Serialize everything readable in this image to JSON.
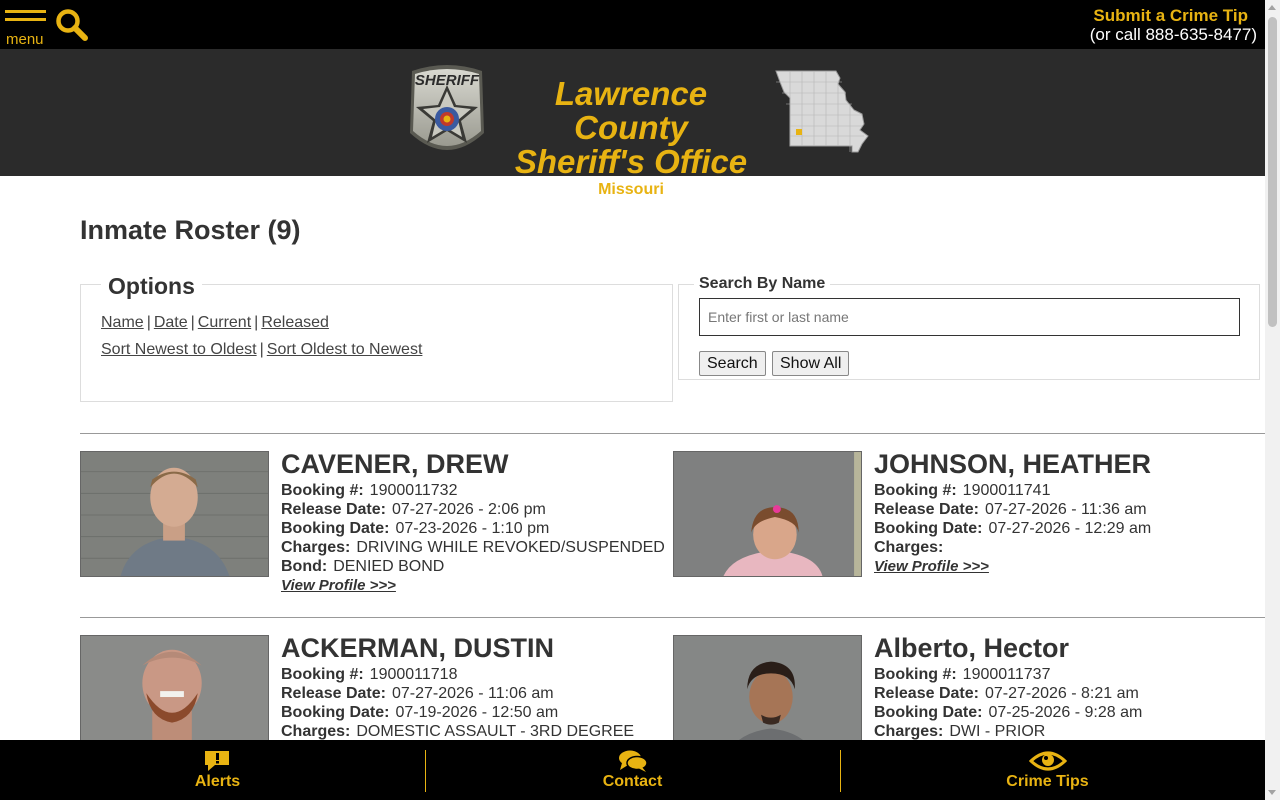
{
  "topbar": {
    "menu_label": "menu",
    "crime_tip_link": "Submit a Crime Tip",
    "crime_tip_phone": "(or call 888-635-8477)"
  },
  "header": {
    "badge_text": "SHERIFF",
    "title_line1": "Lawrence County",
    "title_line2": "Sheriff's Office",
    "state": "Missouri"
  },
  "page": {
    "title": "Inmate Roster (9)"
  },
  "options": {
    "legend": "Options",
    "sort_links": [
      "Name",
      "Date",
      "Current",
      "Released"
    ],
    "order_links": [
      "Sort Newest to Oldest",
      "Sort Oldest to Newest"
    ]
  },
  "search": {
    "legend": "Search By Name",
    "placeholder": "Enter first or last name",
    "search_button": "Search",
    "show_all_button": "Show All"
  },
  "labels": {
    "booking_no": "Booking #:",
    "release_date": "Release Date:",
    "booking_date": "Booking Date:",
    "charges": "Charges:",
    "bond": "Bond:",
    "view_profile": "View Profile >>>"
  },
  "inmates": [
    {
      "name": "CAVENER, DREW",
      "booking_no": "1900011732",
      "release_date": "07-27-2026 - 2:06 pm",
      "booking_date": "07-23-2026 - 1:10 pm",
      "charges": "DRIVING WHILE REVOKED/SUSPENDED",
      "bond": "DENIED BOND"
    },
    {
      "name": "JOHNSON, HEATHER",
      "booking_no": "1900011741",
      "release_date": "07-27-2026 - 11:36 am",
      "booking_date": "07-27-2026 - 12:29 am",
      "charges": ""
    },
    {
      "name": "ACKERMAN, DUSTIN",
      "booking_no": "1900011718",
      "release_date": "07-27-2026 - 11:06 am",
      "booking_date": "07-19-2026 - 12:50 am",
      "charges": "DOMESTIC ASSAULT - 3RD DEGREE"
    },
    {
      "name": "Alberto, Hector",
      "booking_no": "1900011737",
      "release_date": "07-27-2026 - 8:21 am",
      "booking_date": "07-25-2026 - 9:28 am",
      "charges": "DWI - PRIOR"
    }
  ],
  "bottom_nav": {
    "alerts": "Alerts",
    "contact": "Contact",
    "crime_tips": "Crime Tips"
  },
  "colors": {
    "accent": "#e8b312",
    "topbar_bg": "#000000",
    "banner_bg": "#2b2b2b"
  },
  "icons": [
    "menu-icon",
    "search-icon",
    "sheriff-badge-icon",
    "missouri-map-icon",
    "alerts-icon",
    "contact-icon",
    "eye-icon"
  ]
}
